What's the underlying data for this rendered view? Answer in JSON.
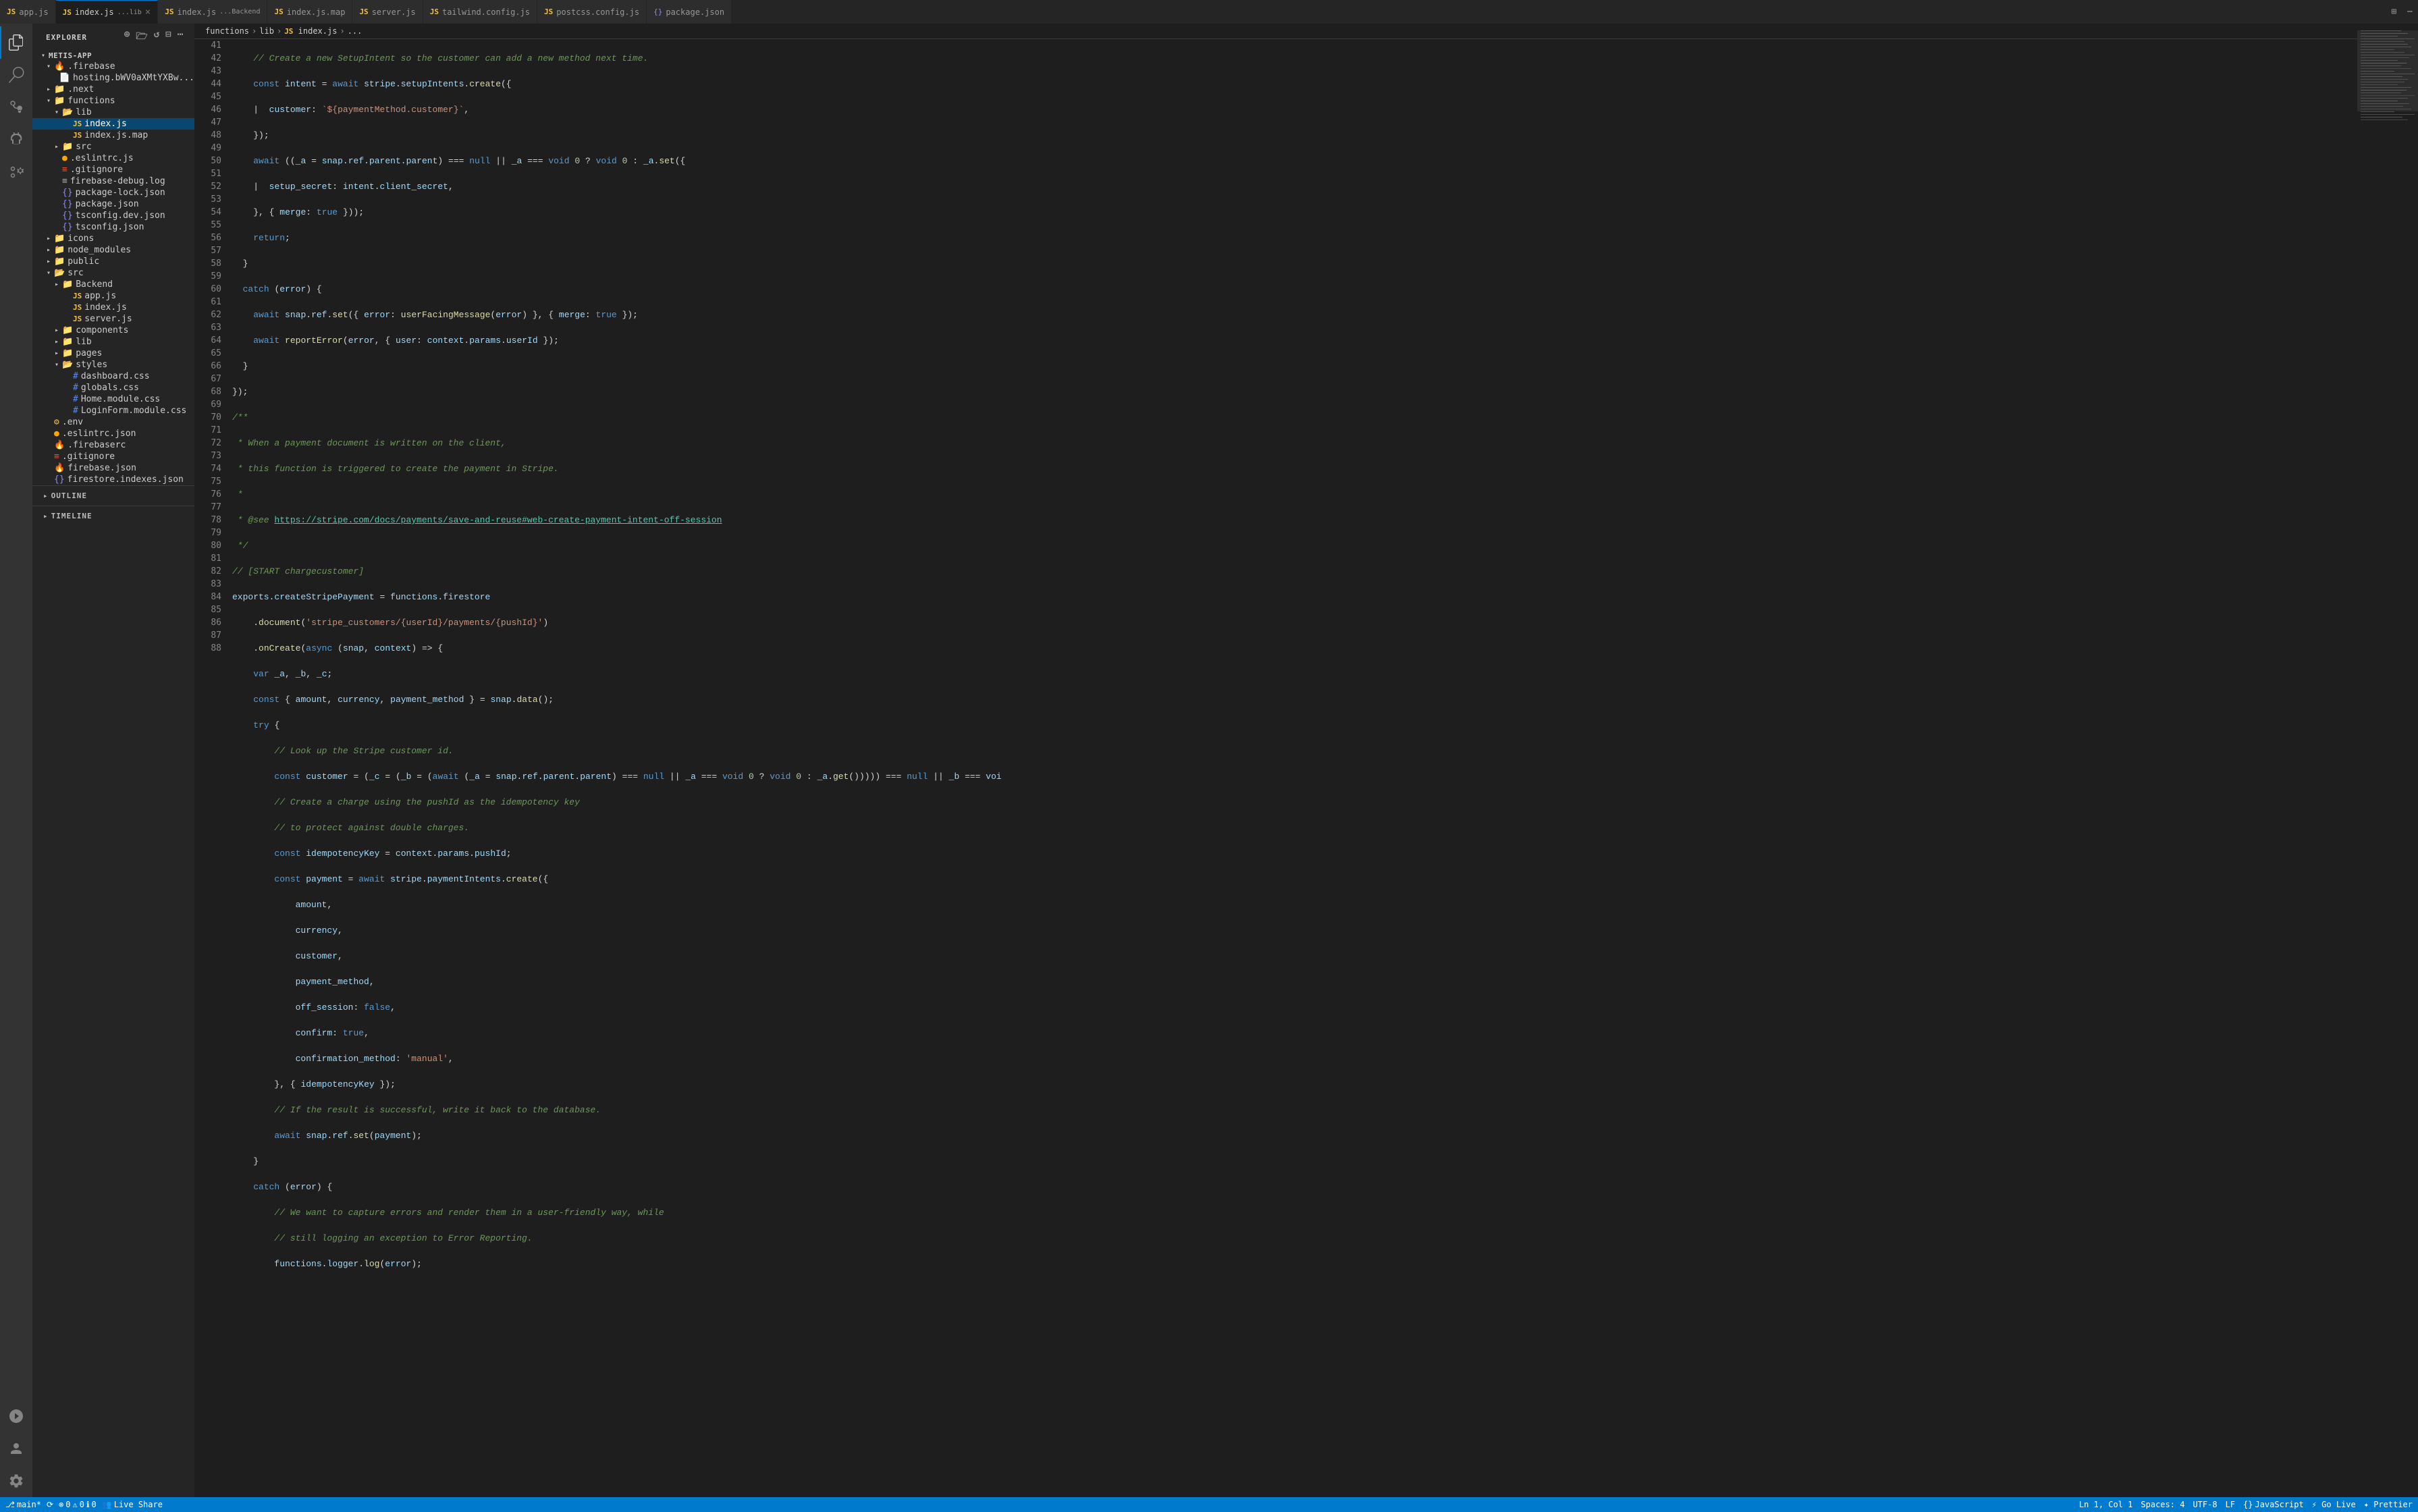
{
  "tabs": [
    {
      "id": "app-js",
      "label": "app.js",
      "icon": "js",
      "active": false,
      "path": ""
    },
    {
      "id": "index-js-lib",
      "label": "index.js",
      "path": "...lib",
      "icon": "js",
      "active": true,
      "closeable": true
    },
    {
      "id": "index-js",
      "label": "index.js",
      "path": "...Backend",
      "icon": "js",
      "active": false
    },
    {
      "id": "index-js-map",
      "label": "index.js.map",
      "path": "",
      "icon": "js",
      "active": false
    },
    {
      "id": "server-js",
      "label": "server.js",
      "path": "",
      "icon": "js",
      "active": false
    },
    {
      "id": "tailwind-config",
      "label": "tailwind.config.js",
      "path": "",
      "icon": "js",
      "active": false
    },
    {
      "id": "postcss-config",
      "label": "postcss.config.js",
      "path": "",
      "icon": "js",
      "active": false
    },
    {
      "id": "package-json",
      "label": "package.json",
      "path": "",
      "icon": "json",
      "active": false
    }
  ],
  "breadcrumb": {
    "parts": [
      "functions",
      ">",
      "lib",
      ">",
      "index.js",
      ">",
      "..."
    ]
  },
  "explorer": {
    "title": "EXPLORER",
    "project": "METIS-APP",
    "tree": [
      {
        "level": 1,
        "type": "folder",
        "name": ".firebase",
        "expanded": true,
        "icon": "firebase"
      },
      {
        "level": 2,
        "type": "file",
        "name": "hosting.bWV0aXMtYXBw...",
        "icon": "file"
      },
      {
        "level": 1,
        "type": "folder",
        "name": ".next",
        "expanded": false,
        "icon": "folder"
      },
      {
        "level": 1,
        "type": "folder",
        "name": "functions",
        "expanded": true,
        "icon": "folder"
      },
      {
        "level": 2,
        "type": "folder",
        "name": "lib",
        "expanded": true,
        "icon": "folder"
      },
      {
        "level": 3,
        "type": "file",
        "name": "index.js",
        "icon": "js",
        "selected": true
      },
      {
        "level": 3,
        "type": "file",
        "name": "index.js.map",
        "icon": "js"
      },
      {
        "level": 2,
        "type": "folder",
        "name": "src",
        "expanded": false,
        "icon": "folder"
      },
      {
        "level": 2,
        "type": "file",
        "name": ".eslintrc.js",
        "icon": "eslint"
      },
      {
        "level": 2,
        "type": "file",
        "name": ".gitignore",
        "icon": "git"
      },
      {
        "level": 2,
        "type": "file",
        "name": "firebase-debug.log",
        "icon": "log"
      },
      {
        "level": 2,
        "type": "file",
        "name": "package-lock.json",
        "icon": "json"
      },
      {
        "level": 2,
        "type": "file",
        "name": "package.json",
        "icon": "json"
      },
      {
        "level": 2,
        "type": "file",
        "name": "tsconfig.dev.json",
        "icon": "json"
      },
      {
        "level": 2,
        "type": "file",
        "name": "tsconfig.json",
        "icon": "json"
      },
      {
        "level": 1,
        "type": "folder",
        "name": "icons",
        "expanded": false,
        "icon": "folder"
      },
      {
        "level": 1,
        "type": "folder",
        "name": "node_modules",
        "expanded": false,
        "icon": "folder"
      },
      {
        "level": 1,
        "type": "folder",
        "name": "public",
        "expanded": false,
        "icon": "folder"
      },
      {
        "level": 1,
        "type": "folder",
        "name": "src",
        "expanded": true,
        "icon": "folder"
      },
      {
        "level": 2,
        "type": "folder",
        "name": "Backend",
        "expanded": false,
        "icon": "folder"
      },
      {
        "level": 3,
        "type": "file",
        "name": "app.js",
        "icon": "js"
      },
      {
        "level": 3,
        "type": "file",
        "name": "index.js",
        "icon": "js"
      },
      {
        "level": 3,
        "type": "file",
        "name": "server.js",
        "icon": "js"
      },
      {
        "level": 2,
        "type": "folder",
        "name": "components",
        "expanded": false,
        "icon": "folder"
      },
      {
        "level": 2,
        "type": "folder",
        "name": "lib",
        "expanded": false,
        "icon": "folder"
      },
      {
        "level": 2,
        "type": "folder",
        "name": "pages",
        "expanded": false,
        "icon": "folder"
      },
      {
        "level": 2,
        "type": "folder",
        "name": "styles",
        "expanded": true,
        "icon": "folder"
      },
      {
        "level": 3,
        "type": "file",
        "name": "dashboard.css",
        "icon": "css"
      },
      {
        "level": 3,
        "type": "file",
        "name": "globals.css",
        "icon": "css"
      },
      {
        "level": 3,
        "type": "file",
        "name": "Home.module.css",
        "icon": "css"
      },
      {
        "level": 3,
        "type": "file",
        "name": "LoginForm.module.css",
        "icon": "css"
      },
      {
        "level": 1,
        "type": "file",
        "name": ".env",
        "icon": "env"
      },
      {
        "level": 1,
        "type": "file",
        "name": ".eslintrc.json",
        "icon": "json"
      },
      {
        "level": 1,
        "type": "file",
        "name": ".firebaserc",
        "icon": "firebase"
      },
      {
        "level": 1,
        "type": "file",
        "name": ".gitignore",
        "icon": "git"
      },
      {
        "level": 1,
        "type": "file",
        "name": "firebase.json",
        "icon": "firebase"
      },
      {
        "level": 1,
        "type": "file",
        "name": "firestore.indexes.json",
        "icon": "json"
      }
    ]
  },
  "code_lines": [
    {
      "num": 41,
      "text": "    // Create a new SetupIntent so the customer can add a new method next time."
    },
    {
      "num": 42,
      "text": "    const intent = await stripe.setupIntents.create({"
    },
    {
      "num": 43,
      "text": "      customer: `${paymentMethod.customer}`,"
    },
    {
      "num": 44,
      "text": "    });"
    },
    {
      "num": 45,
      "text": "    await ((_a = snap.ref.parent.parent) === null || _a === void 0 ? void 0 : _a.set({"
    },
    {
      "num": 46,
      "text": "      setup_secret: intent.client_secret,"
    },
    {
      "num": 47,
      "text": "    }, { merge: true }));"
    },
    {
      "num": 48,
      "text": "    return;"
    },
    {
      "num": 49,
      "text": "  }"
    },
    {
      "num": 50,
      "text": "  catch (error) {"
    },
    {
      "num": 51,
      "text": "    await snap.ref.set({ error: userFacingMessage(error) }, { merge: true });"
    },
    {
      "num": 52,
      "text": "    await reportError(error, { user: context.params.userId });"
    },
    {
      "num": 53,
      "text": "  }"
    },
    {
      "num": 54,
      "text": "});"
    },
    {
      "num": 55,
      "text": "/**"
    },
    {
      "num": 56,
      "text": " * When a payment document is written on the client,"
    },
    {
      "num": 57,
      "text": " * this function is triggered to create the payment in Stripe."
    },
    {
      "num": 58,
      "text": " *"
    },
    {
      "num": 59,
      "text": " * @see https://stripe.com/docs/payments/save-and-reuse#web-create-payment-intent-off-session"
    },
    {
      "num": 60,
      "text": " */"
    },
    {
      "num": 61,
      "text": "// [START chargecustomer]"
    },
    {
      "num": 62,
      "text": "exports.createStripePayment = functions.firestore"
    },
    {
      "num": 63,
      "text": "    .document('stripe_customers/{userId}/payments/{pushId}')"
    },
    {
      "num": 64,
      "text": "    .onCreate(async (snap, context) => {"
    },
    {
      "num": 65,
      "text": "    var _a, _b, _c;"
    },
    {
      "num": 66,
      "text": "    const { amount, currency, payment_method } = snap.data();"
    },
    {
      "num": 67,
      "text": "    try {"
    },
    {
      "num": 68,
      "text": "        // Look up the Stripe customer id."
    },
    {
      "num": 69,
      "text": "        const customer = (_c = (_b = (await (_a = snap.ref.parent.parent) === null || _a === void 0 ? void 0 : _a.get()))) === null || _b === voi"
    },
    {
      "num": 70,
      "text": "        // Create a charge using the pushId as the idempotency key"
    },
    {
      "num": 71,
      "text": "        // to protect against double charges."
    },
    {
      "num": 72,
      "text": "        const idempotencyKey = context.params.pushId;"
    },
    {
      "num": 73,
      "text": "        const payment = await stripe.paymentIntents.create({"
    },
    {
      "num": 74,
      "text": "            amount,"
    },
    {
      "num": 75,
      "text": "            currency,"
    },
    {
      "num": 76,
      "text": "            customer,"
    },
    {
      "num": 77,
      "text": "            payment_method,"
    },
    {
      "num": 78,
      "text": "            off_session: false,"
    },
    {
      "num": 79,
      "text": "            confirm: true,"
    },
    {
      "num": 80,
      "text": "            confirmation_method: 'manual',"
    },
    {
      "num": 81,
      "text": "        }, { idempotencyKey });"
    },
    {
      "num": 82,
      "text": "        // If the result is successful, write it back to the database."
    },
    {
      "num": 83,
      "text": "        await snap.ref.set(payment);"
    },
    {
      "num": 84,
      "text": "    }"
    },
    {
      "num": 85,
      "text": "    catch (error) {"
    },
    {
      "num": 86,
      "text": "        // We want to capture errors and render them in a user-friendly way, while"
    },
    {
      "num": 87,
      "text": "        // still logging an exception to Error Reporting."
    },
    {
      "num": 88,
      "text": "        functions.logger.log(error);"
    }
  ],
  "status_bar": {
    "branch": "main*",
    "sync": "⟳",
    "errors": "0",
    "warnings": "0",
    "info": "0",
    "live_share": "Live Share",
    "position": "Ln 1, Col 1",
    "spaces": "Spaces: 4",
    "encoding": "UTF-8",
    "line_ending": "LF",
    "language": "JavaScript",
    "go_live": "⚡ Go Live",
    "prettier": "✦ Prettier"
  },
  "outline": {
    "label": "OUTLINE"
  },
  "timeline": {
    "label": "TIMELINE"
  }
}
